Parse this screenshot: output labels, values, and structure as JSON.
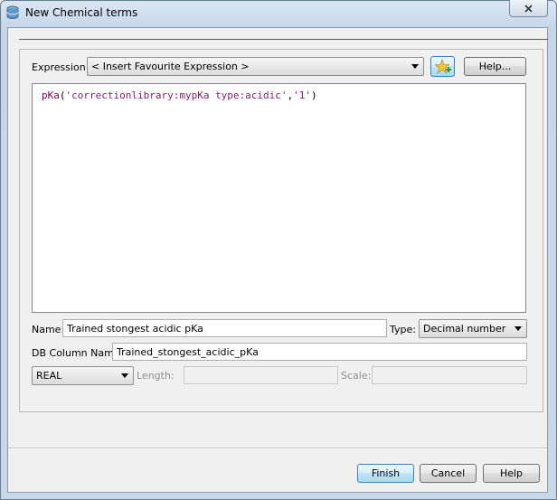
{
  "window": {
    "title": "New Chemical terms"
  },
  "expression": {
    "label": "Expression:",
    "selected": "< Insert Favourite Expression >",
    "help_label": "Help..."
  },
  "editor": {
    "fn": "pKa",
    "open": "(",
    "arg1": "'correctionlibrary:mypKa type:acidic'",
    "comma": ",",
    "arg2": "'1'",
    "close": ")"
  },
  "name_field": {
    "label": "Name:",
    "value": "Trained stongest acidic pKa"
  },
  "type_field": {
    "label": "Type:",
    "selected": "Decimal number"
  },
  "db_column": {
    "label": "DB Column Name:",
    "value": "Trained_stongest_acidic_pKa"
  },
  "sql_type": {
    "selected": "REAL",
    "length_label": "Length:",
    "scale_label": "Scale:"
  },
  "footer": {
    "finish_label": "Finish",
    "cancel_label": "Cancel",
    "help_label": "Help"
  }
}
